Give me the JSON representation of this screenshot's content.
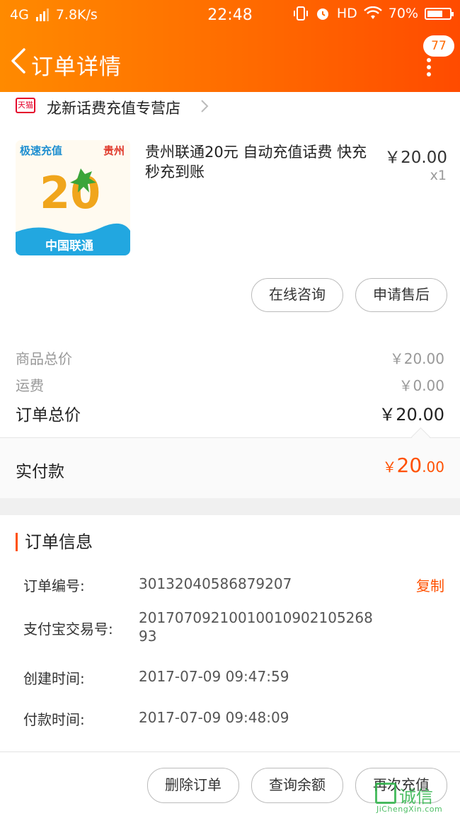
{
  "status_bar": {
    "network": "4G",
    "speed": "7.8K/s",
    "time": "22:48",
    "hd": "HD",
    "battery": "70%",
    "battery_level": 0.7
  },
  "nav": {
    "title": "订单详情",
    "badge": "77"
  },
  "shop": {
    "badge_label": "天猫",
    "name": "龙新话费充值专营店"
  },
  "product": {
    "title": "贵州联通20元 自动充值话费 快充秒充到账",
    "price": "￥20.00",
    "quantity": "x1",
    "image": {
      "tag_left": "极速充值",
      "tag_right": "贵州",
      "amount": "20",
      "brand": "中国联通"
    },
    "actions": {
      "consult": "在线咨询",
      "after_sales": "申请售后"
    }
  },
  "summary": {
    "goods_label": "商品总价",
    "goods_value": "￥20.00",
    "shipping_label": "运费",
    "shipping_value": "￥0.00",
    "total_label": "订单总价",
    "total_value": "￥20.00",
    "paid_label": "实付款",
    "paid_currency": "￥",
    "paid_int": "20",
    "paid_dec": ".00"
  },
  "order_info": {
    "heading": "订单信息",
    "copy_label": "复制",
    "rows": [
      {
        "label": "订单编号:",
        "value": "30132040586879207"
      },
      {
        "label": "支付宝交易号:",
        "value": "20170709210010010902105268 93"
      },
      {
        "label": "创建时间:",
        "value": "2017-07-09 09:47:59"
      },
      {
        "label": "付款时间:",
        "value": "2017-07-09 09:48:09"
      }
    ]
  },
  "bottom_bar": {
    "delete": "删除订单",
    "balance": "查询余额",
    "recharge": "再次充值"
  },
  "watermark": {
    "main": "诚信",
    "sub": "JiChengXin.com"
  }
}
